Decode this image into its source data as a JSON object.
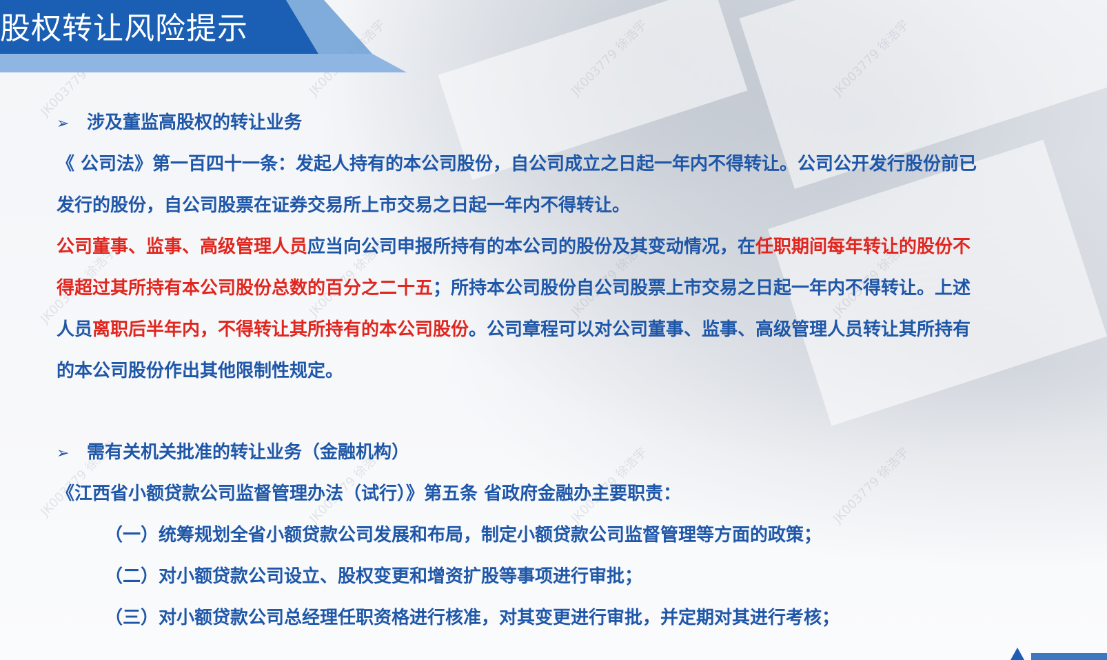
{
  "title": "股权转让风险提示",
  "watermark_text": "JK003779 徐浩宇",
  "section1": {
    "heading": "涉及董监高股权的转让业务",
    "line1": "《 公司法》第一百四十一条：发起人持有的本公司股份，自公司成立之日起一年内不得转让。公司公开发行股份前已",
    "line2": "发行的股份，自公司股票在证券交易所上市交易之日起一年内不得转让。",
    "line3_red1": "公司董事、监事、高级管理人员",
    "line3_blue": "应当向公司申报所持有的本公司的股份及其变动情况，在",
    "line3_red2": "任职期间每年转让的股份不",
    "line4_red": "得超过其所持有本公司股份总数的百分之二十五",
    "line4_blue": "；所持本公司股份自公司股票上市交易之日起一年内不得转让。上述",
    "line5_blue1": "人员",
    "line5_red": "离职后半年内，不得转让其所持有的本公司股份",
    "line5_blue2": "。公司章程可以对公司董事、监事、高级管理人员转让其所持有",
    "line6": "的本公司股份作出其他限制性规定。"
  },
  "section2": {
    "heading": "需有关机关批准的转让业务（金融机构）",
    "line1": "《江西省小额贷款公司监督管理办法（试行）》第五条 省政府金融办主要职责：",
    "item1": "（一）统筹规划全省小额贷款公司发展和布局，制定小额贷款公司监督管理等方面的政策；",
    "item2": "（二）对小额贷款公司设立、股权变更和增资扩股等事项进行审批；",
    "item3": "（三）对小额贷款公司总经理任职资格进行核准，对其变更进行审批，并定期对其进行考核；"
  },
  "colors": {
    "title_banner": "#1a5fb4",
    "title_banner_light": "#6b9fd6",
    "body_blue": "#1f57a8",
    "highlight_red": "#e0261f"
  }
}
